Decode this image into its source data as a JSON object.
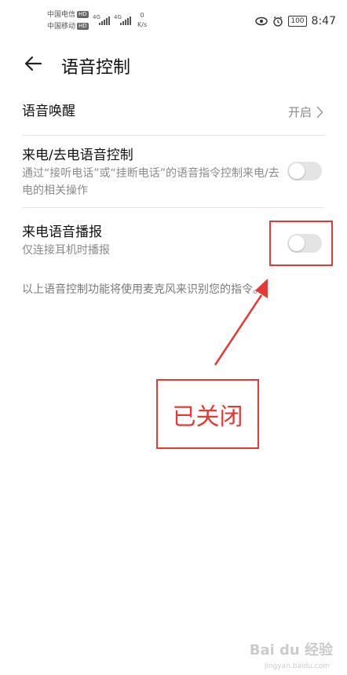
{
  "status_bar": {
    "carrier1": "中国电信",
    "carrier2": "中国移动",
    "hd": "HD",
    "net1": "4G",
    "net2": "4G",
    "speed_value": "0",
    "speed_unit": "K/s",
    "battery": "100",
    "time": "8:47"
  },
  "header": {
    "title": "语音控制"
  },
  "settings": {
    "wake": {
      "label": "语音唤醒",
      "value": "开启"
    },
    "call_control": {
      "label": "来电/去电语音控制",
      "description": "通过“接听电话”或“挂断电话”的语音指令控制来电/去电的相关操作",
      "enabled": false
    },
    "announce": {
      "label": "来电语音播报",
      "description": "仅连接耳机时播报",
      "enabled": false
    },
    "footnote": "以上语音控制功能将使用麦克风来识别您的指令。"
  },
  "annotation": {
    "callout": "已关闭",
    "color": "#e53935"
  },
  "watermark": {
    "text": "Bai du 经验",
    "sub": "jingyan.baidu.com"
  }
}
